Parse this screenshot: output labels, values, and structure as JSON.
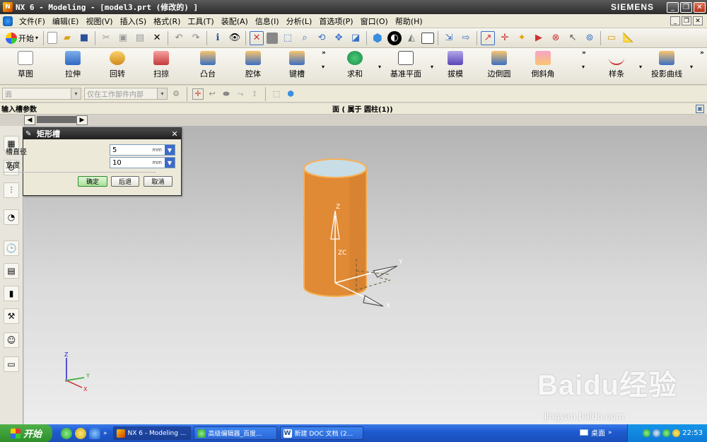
{
  "window": {
    "app_icon": "nx-logo-icon",
    "title": "NX 6 - Modeling - [model3.prt  (修改的) ]",
    "brand": "SIEMENS",
    "controls": [
      "minimize",
      "restore",
      "close"
    ]
  },
  "menubar": {
    "items": [
      "文件(F)",
      "编辑(E)",
      "视图(V)",
      "插入(S)",
      "格式(R)",
      "工具(T)",
      "装配(A)",
      "信息(I)",
      "分析(L)",
      "首选项(P)",
      "窗口(O)",
      "帮助(H)"
    ]
  },
  "standard_toolbar": {
    "start_label": "开始",
    "icons": [
      "new-icon",
      "open-icon",
      "save-icon",
      "cut-icon",
      "copy-icon",
      "paste-icon",
      "delete-icon",
      "undo-icon",
      "redo-icon",
      "info-icon",
      "view-icon",
      "fit-icon",
      "zoom-icon",
      "rotate-icon",
      "render-icon",
      "shaded-icon",
      "wcs-icon",
      "layer-icon",
      "snap-icon",
      "measure-icon"
    ]
  },
  "feature_toolbar": {
    "items": [
      {
        "label": "草图",
        "icon": "sketch-icon"
      },
      {
        "label": "拉伸",
        "icon": "extrude-icon"
      },
      {
        "label": "回转",
        "icon": "revolve-icon"
      },
      {
        "label": "扫掠",
        "icon": "sweep-icon"
      },
      {
        "label": "凸台",
        "icon": "boss-icon"
      },
      {
        "label": "腔体",
        "icon": "pocket-icon"
      },
      {
        "label": "键槽",
        "icon": "slot-icon"
      },
      {
        "label": "求和",
        "icon": "unite-icon"
      },
      {
        "label": "基准平面",
        "icon": "datum-plane-icon"
      },
      {
        "label": "拔模",
        "icon": "draft-icon"
      },
      {
        "label": "边倒圆",
        "icon": "edge-blend-icon"
      },
      {
        "label": "倒斜角",
        "icon": "chamfer-icon"
      },
      {
        "label": "样条",
        "icon": "spline-icon"
      },
      {
        "label": "投影曲线",
        "icon": "project-curve-icon"
      }
    ]
  },
  "selection_bar": {
    "filter_value": "面",
    "scope_value": "仅在工作部件内部"
  },
  "cue_line": {
    "prompt": "输入槽参数",
    "status": "面 ( 属于 圆柱(1))"
  },
  "dialog": {
    "title": "矩形槽",
    "fields": [
      {
        "label": "槽直径",
        "value": "5",
        "unit": "mm"
      },
      {
        "label": "宽度",
        "value": "10",
        "unit": "mm"
      }
    ],
    "buttons": {
      "ok": "确定",
      "back": "后退",
      "cancel": "取消"
    }
  },
  "viewport": {
    "axes_labels": {
      "z": "Z",
      "zc": "ZC",
      "y": "Y",
      "x": "X"
    },
    "triad_labels": {
      "z": "Z",
      "y": "Y",
      "x": "X"
    },
    "colors": {
      "cylinder": "#e08a35",
      "cylinder_top": "#c8dde6",
      "edge": "#f7b055"
    }
  },
  "taskbar": {
    "start_label": "开始",
    "tasks": [
      {
        "label": "NX 6 - Modeling ...",
        "active": true
      },
      {
        "label": "高级编辑器_百度...",
        "active": false
      },
      {
        "label": "新建 DOC 文档 (2...",
        "active": false
      }
    ],
    "desktop_label": "桌面",
    "clock": "22:53"
  },
  "watermark": {
    "main": "Baidu经验",
    "sub": "jingyan.baidu.com"
  }
}
